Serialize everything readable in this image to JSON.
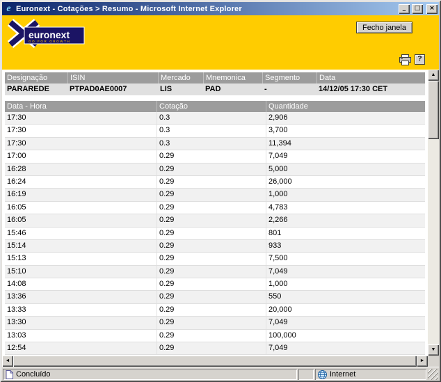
{
  "window": {
    "title": "Euronext - Cotações > Resumo - Microsoft Internet Explorer",
    "controls": {
      "minimize": "_",
      "maximize": "□",
      "close": "×"
    }
  },
  "banner": {
    "logo_text": "euronext",
    "logo_tagline": "GO FOR GROWTH",
    "close_window_button": "Fecho janela",
    "help_icon": "?"
  },
  "icons": {
    "ie": "e",
    "up": "▲",
    "down": "▼",
    "left": "◄",
    "right": "►"
  },
  "summary_table": {
    "headers": [
      "Designação",
      "ISIN",
      "Mercado",
      "Mnemonica",
      "Segmento",
      "Data"
    ],
    "row": [
      "PARAREDE",
      "PTPAD0AE0007",
      "LIS",
      "PAD",
      "-",
      "14/12/05 17:30 CET"
    ]
  },
  "quotes_table": {
    "headers": [
      "Data - Hora",
      "Cotação",
      "Quantidade"
    ],
    "rows": [
      [
        "17:30",
        "0.3",
        "2,906"
      ],
      [
        "17:30",
        "0.3",
        "3,700"
      ],
      [
        "17:30",
        "0.3",
        "11,394"
      ],
      [
        "17:00",
        "0.29",
        "7,049"
      ],
      [
        "16:28",
        "0.29",
        "5,000"
      ],
      [
        "16:24",
        "0.29",
        "26,000"
      ],
      [
        "16:19",
        "0.29",
        "1,000"
      ],
      [
        "16:05",
        "0.29",
        "4,783"
      ],
      [
        "16:05",
        "0.29",
        "2,266"
      ],
      [
        "15:46",
        "0.29",
        "801"
      ],
      [
        "15:14",
        "0.29",
        "933"
      ],
      [
        "15:13",
        "0.29",
        "7,500"
      ],
      [
        "15:10",
        "0.29",
        "7,049"
      ],
      [
        "14:08",
        "0.29",
        "1,000"
      ],
      [
        "13:36",
        "0.29",
        "550"
      ],
      [
        "13:33",
        "0.29",
        "20,000"
      ],
      [
        "13:30",
        "0.29",
        "7,049"
      ],
      [
        "13:03",
        "0.29",
        "100,000"
      ],
      [
        "12:54",
        "0.29",
        "7,049"
      ]
    ]
  },
  "status": {
    "text": "Concluído",
    "zone": "Internet"
  },
  "colors": {
    "chrome": "#D6D3CE",
    "titlebar_left": "#0A246A",
    "titlebar_right": "#A6CAF0",
    "brand_yellow": "#FFCC00",
    "logo_navy": "#1B1464",
    "table_header": "#9C9C9C"
  }
}
